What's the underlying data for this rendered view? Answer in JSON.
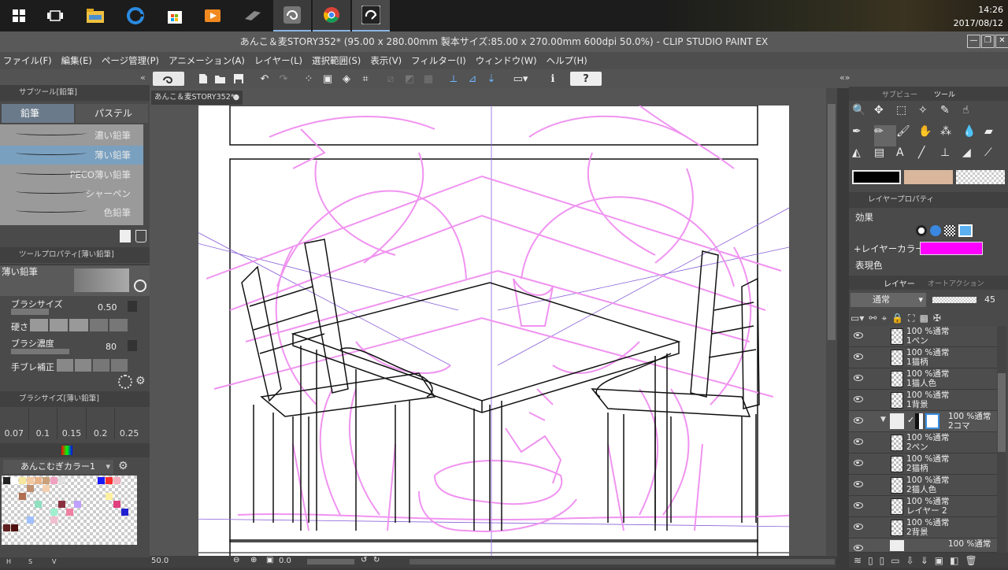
{
  "taskbar": {
    "time": "14:26",
    "date": "2017/08/12",
    "apps": [
      "windows-start",
      "task-view",
      "file-explorer",
      "edge",
      "store",
      "media-player",
      "drive-app",
      "clip-studio",
      "chrome",
      "clip-studio-paint"
    ]
  },
  "window": {
    "title": "あんこ＆麦STORY352* (95.00 x 280.00mm 製本サイズ:85.00 x 270.00mm 600dpi 50.0%)  - CLIP STUDIO PAINT EX"
  },
  "menu": [
    "ファイル(F)",
    "編集(E)",
    "ページ管理(P)",
    "アニメーション(A)",
    "レイヤー(L)",
    "選択範囲(S)",
    "表示(V)",
    "フィルター(I)",
    "ウィンドウ(W)",
    "ヘルプ(H)"
  ],
  "document_tab": "あんこ＆麦STORY352*",
  "subtool": {
    "panel_title": "サブツール[鉛筆]",
    "tabs": [
      "鉛筆",
      "パステル"
    ],
    "items": [
      "濃い鉛筆",
      "薄い鉛筆",
      "PECO薄い鉛筆",
      "シャーペン",
      "色鉛筆"
    ],
    "selected": "薄い鉛筆"
  },
  "tool_property": {
    "panel_title": "ツールプロパティ[薄い鉛筆]",
    "tool_name": "薄い鉛筆",
    "brush_size_label": "ブラシサイズ",
    "brush_size": "0.50",
    "hardness_label": "硬さ",
    "density_label": "ブラシ濃度",
    "density": "80",
    "stabilization_label": "手ブレ補正"
  },
  "brush_size_panel": {
    "panel_title": "ブラシサイズ[薄い鉛筆]",
    "sizes": [
      "0.07",
      "0.1",
      "0.15",
      "0.2",
      "0.25"
    ]
  },
  "color_set": {
    "name": "あんこむぎカラー1",
    "footer": [
      "H",
      "S",
      "V"
    ]
  },
  "right_tabs": {
    "subview": "サブビュー",
    "tool": "ツール"
  },
  "colors": {
    "main": "#000000",
    "sub": "#d9b79c",
    "layer_color": "#ff00ff",
    "pencil": "#f08ef0"
  },
  "layer_property": {
    "panel_title": "レイヤープロパティ",
    "effect_label": "効果",
    "layer_color_label": "レイヤーカラー",
    "display_color_label": "表現色"
  },
  "layers_panel": {
    "title": "レイヤー",
    "auto_action": "オートアクション",
    "blend_mode": "通常",
    "opacity": "45",
    "layers": [
      {
        "line1": "100 %通常",
        "line2": "1ペン"
      },
      {
        "line1": "100 %通常",
        "line2": "1猫柄"
      },
      {
        "line1": "100 %通常",
        "line2": "1猫人色"
      },
      {
        "line1": "100 %通常",
        "line2": "1背景"
      },
      {
        "line1": "100 %通常",
        "line2": "2コマ"
      },
      {
        "line1": "100 %通常",
        "line2": "2ペン"
      },
      {
        "line1": "100 %通常",
        "line2": "2猫柄"
      },
      {
        "line1": "100 %通常",
        "line2": "2猫人色"
      },
      {
        "line1": "100 %通常",
        "line2": "レイヤー 2"
      },
      {
        "line1": "100 %通常",
        "line2": "2背景"
      },
      {
        "line1": "100 %通常",
        "line2": ""
      }
    ]
  },
  "status": {
    "zoom": "50.0",
    "angle": "0.0"
  }
}
